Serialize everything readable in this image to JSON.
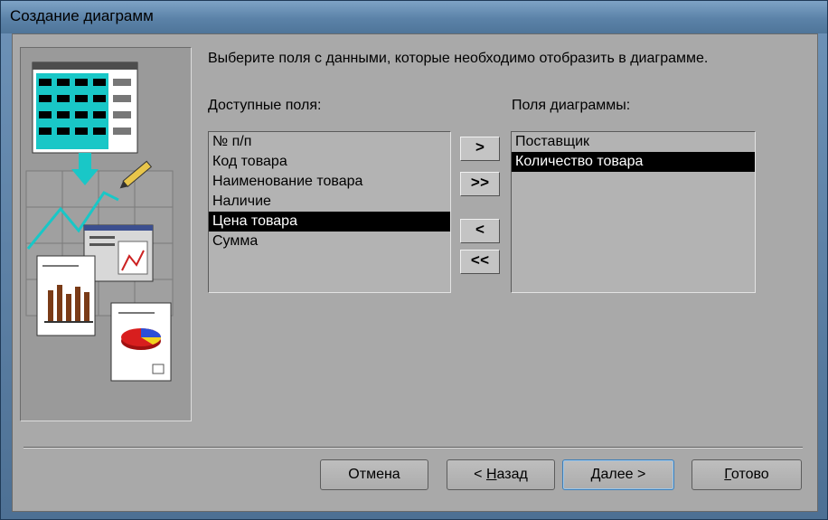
{
  "window": {
    "title": "Создание диаграмм"
  },
  "instruction": "Выберите поля с данными, которые необходимо отобразить в диаграмме.",
  "available_fields": {
    "label": "Доступные поля:",
    "items": [
      "№ п/п",
      "Код товара",
      "Наименование товара",
      "Наличие",
      "Цена товара",
      "Сумма"
    ],
    "selected": "Цена товара"
  },
  "chart_fields": {
    "label": "Поля диаграммы:",
    "items": [
      "Поставщик",
      "Количество товара"
    ],
    "selected": "Количество товара"
  },
  "move_buttons": {
    "add_one": ">",
    "add_all": ">>",
    "remove_one": "<",
    "remove_all": "<<"
  },
  "footer": {
    "cancel": "Отмена",
    "back_prefix": "< ",
    "back_mnemonic": "Н",
    "back_rest": "азад",
    "next_mnemonic": "Д",
    "next_rest": "алее >",
    "finish_mnemonic": "Г",
    "finish_rest": "отово"
  },
  "colors": {
    "selection": "#000000",
    "accent_cyan": "#19c7c7",
    "dialog_bg": "#a9a9a9"
  }
}
